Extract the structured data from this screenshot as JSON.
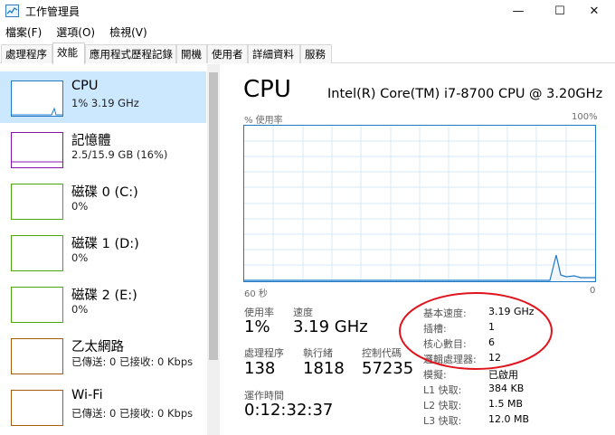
{
  "window": {
    "title": "工作管理員",
    "minimize_glyph": "—",
    "maximize_glyph": "☐",
    "close_glyph": "✕",
    "icon": "task-manager-icon"
  },
  "menu": [
    "檔案(F)",
    "選項(O)",
    "檢視(V)"
  ],
  "tabs": [
    "處理程序",
    "效能",
    "應用程式歷程記錄",
    "開機",
    "使用者",
    "詳細資料",
    "服務"
  ],
  "active_tab": "效能",
  "sidebar": {
    "items": [
      {
        "title": "CPU",
        "sub": "1% 3.19 GHz",
        "color": "#1e7ac7"
      },
      {
        "title": "記憶體",
        "sub": "2.5/15.9 GB (16%)",
        "color": "#8b14a8"
      },
      {
        "title": "磁碟 0 (C:)",
        "sub": "0%",
        "color": "#4da60c"
      },
      {
        "title": "磁碟 1 (D:)",
        "sub": "0%",
        "color": "#4da60c"
      },
      {
        "title": "磁碟 2 (E:)",
        "sub": "0%",
        "color": "#4da60c"
      },
      {
        "title": "乙太網路",
        "sub": "已傳送: 0 已接收: 0 Kbps",
        "color": "#a75a10"
      },
      {
        "title": "Wi-Fi",
        "sub": "已傳送: 0 已接收: 0 Kbps",
        "color": "#a75a10"
      }
    ]
  },
  "main": {
    "title": "CPU",
    "model": "Intel(R) Core(TM) i7-8700 CPU @ 3.20GHz",
    "graph_top_left": "% 使用率",
    "graph_top_right": "100%",
    "graph_bottom_left": "60 秒",
    "graph_bottom_right": "0",
    "graph_color": "#1e7ac7",
    "stats": {
      "usage_label": "使用率",
      "usage_value": "1%",
      "speed_label": "速度",
      "speed_value": "3.19 GHz",
      "processes_label": "處理程序",
      "processes_value": "138",
      "threads_label": "執行緒",
      "threads_value": "1818",
      "handles_label": "控制代碼",
      "handles_value": "57235",
      "uptime_label": "運作時間",
      "uptime_value": "0:12:32:37"
    },
    "specs": [
      {
        "key": "基本速度:",
        "value": "3.19 GHz"
      },
      {
        "key": "插槽:",
        "value": "1"
      },
      {
        "key": "核心數目:",
        "value": "6"
      },
      {
        "key": "邏輯處理器:",
        "value": "12"
      },
      {
        "key": "模擬:",
        "value": "已啟用"
      },
      {
        "key": "L1 快取:",
        "value": "384 KB"
      },
      {
        "key": "L2 快取:",
        "value": "1.5 MB"
      },
      {
        "key": "L3 快取:",
        "value": "12.0 MB"
      }
    ],
    "annotation_color": "#e0141e"
  }
}
